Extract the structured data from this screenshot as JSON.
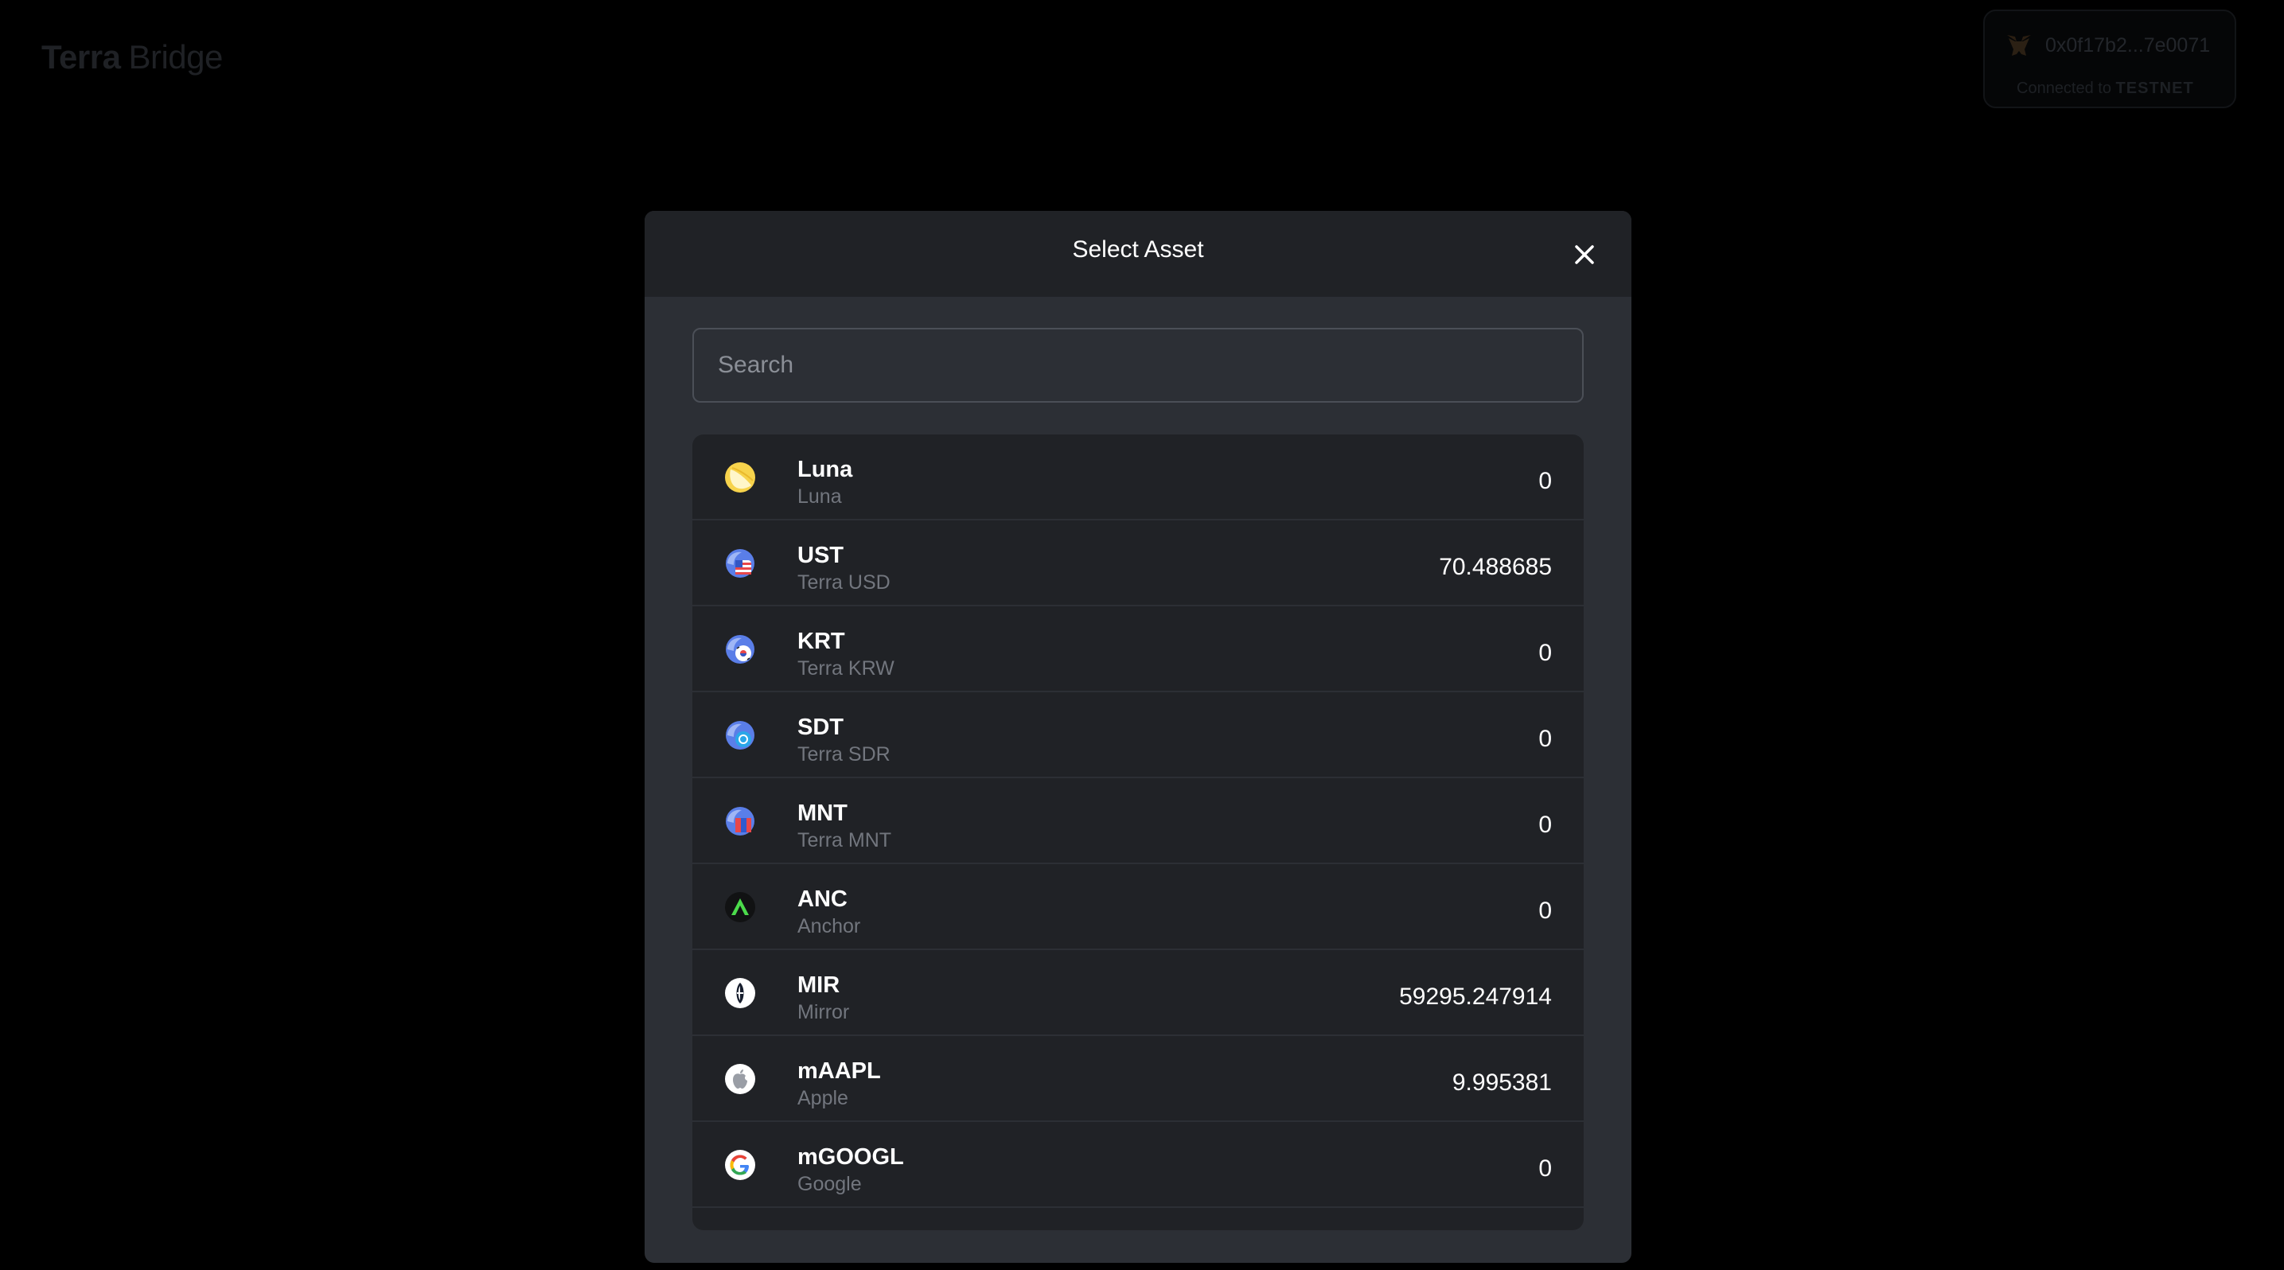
{
  "app": {
    "logo_bold": "Terra",
    "logo_light": "Bridge"
  },
  "wallet": {
    "address": "0x0f17b2...7e0071",
    "network_prefix": "Connected to",
    "network_name": "TESTNET"
  },
  "modal": {
    "title": "Select Asset",
    "search_placeholder": "Search",
    "search_value": ""
  },
  "assets": [
    {
      "symbol": "Luna",
      "name": "Luna",
      "balance": "0",
      "icon": "luna-icon"
    },
    {
      "symbol": "UST",
      "name": "Terra USD",
      "balance": "70.488685",
      "icon": "ust-icon"
    },
    {
      "symbol": "KRT",
      "name": "Terra KRW",
      "balance": "0",
      "icon": "krt-icon"
    },
    {
      "symbol": "SDT",
      "name": "Terra SDR",
      "balance": "0",
      "icon": "sdt-icon"
    },
    {
      "symbol": "MNT",
      "name": "Terra MNT",
      "balance": "0",
      "icon": "mnt-icon"
    },
    {
      "symbol": "ANC",
      "name": "Anchor",
      "balance": "0",
      "icon": "anchor-icon"
    },
    {
      "symbol": "MIR",
      "name": "Mirror",
      "balance": "59295.247914",
      "icon": "mirror-icon"
    },
    {
      "symbol": "mAAPL",
      "name": "Apple",
      "balance": "9.995381",
      "icon": "apple-icon"
    },
    {
      "symbol": "mGOOGL",
      "name": "Google",
      "balance": "0",
      "icon": "google-icon"
    }
  ],
  "colors": {
    "page_bg": "#000000",
    "modal_bg": "#2c2f35",
    "header_bg": "#202226",
    "list_bg": "#202226",
    "text_primary": "#ffffff",
    "text_secondary": "#72767e"
  }
}
